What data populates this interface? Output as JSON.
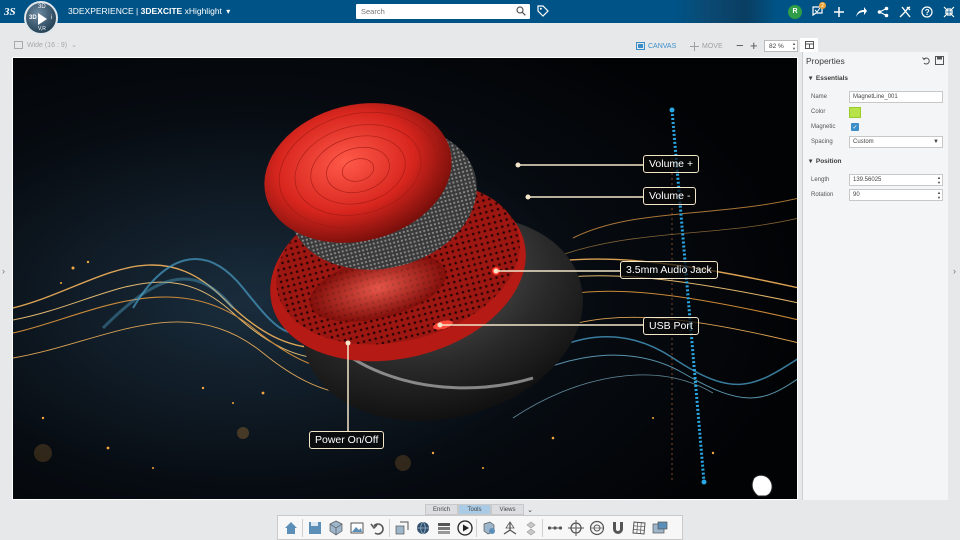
{
  "topbar": {
    "brand_title": "3DEXPERIENCE",
    "app_name": "3DEXCITE",
    "app_sub": "xHighlight",
    "search_placeholder": "Search",
    "compass": {
      "north": "3D",
      "left": "3D",
      "right": "i",
      "bottom": "V,R"
    },
    "avatar_initial": "R",
    "notification_count": "2"
  },
  "canvas_header": {
    "ratio_label": "Wide (16 : 9)",
    "canvas_label": "CANVAS",
    "move_label": "MOVE",
    "zoom_value": "82 %"
  },
  "callouts": {
    "volume_up": "Volume +",
    "volume_down": "Volume -",
    "audio_jack": "3.5mm Audio Jack",
    "usb_port": "USB Port",
    "power": "Power On/Off"
  },
  "properties": {
    "title": "Properties",
    "essentials_label": "Essentials",
    "name_label": "Name",
    "name_value": "MagnetLine_001",
    "color_label": "Color",
    "color_value": "#b6e34a",
    "magnetic_label": "Magnetic",
    "spacing_label": "Spacing",
    "spacing_value": "Custom",
    "position_label": "Position",
    "length_label": "Length",
    "length_value": "139.56025",
    "rotation_label": "Rotation",
    "rotation_value": "90"
  },
  "bottom_tabs": [
    {
      "label": "Enrich"
    },
    {
      "label": "Tools"
    },
    {
      "label": "Views"
    }
  ],
  "colors": {
    "topbar": "#005386",
    "accent": "#3b8ec8",
    "device_red": "#d8261e"
  }
}
